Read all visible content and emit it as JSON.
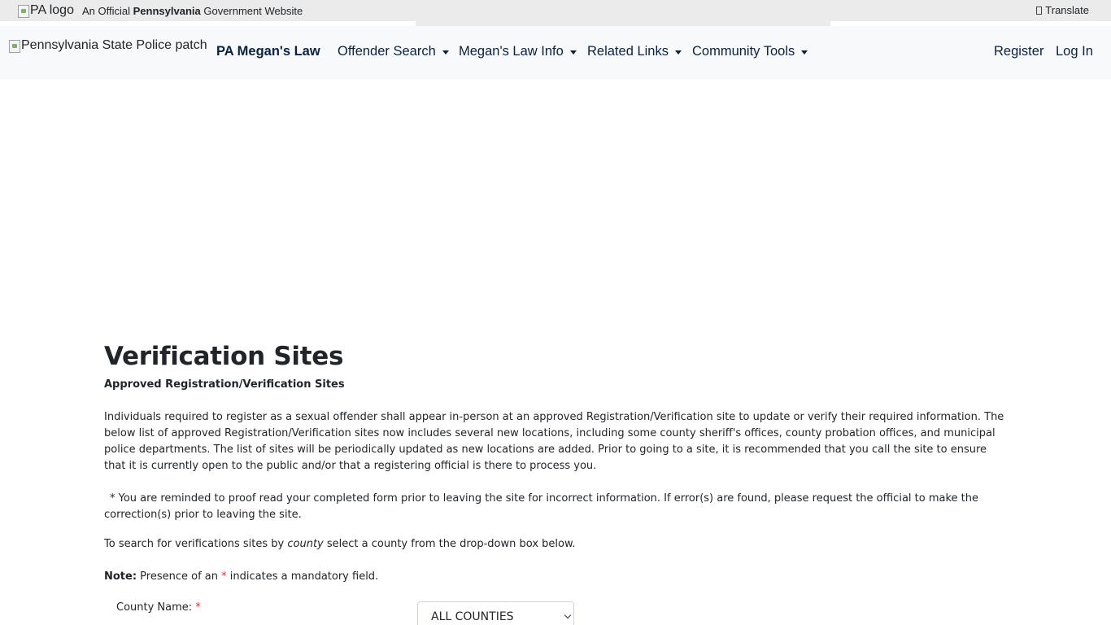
{
  "govbar": {
    "logo_alt": "PA logo",
    "official_prefix": "An Official ",
    "official_state": "Pennsylvania",
    "official_suffix": " Government Website",
    "translate_label": "Translate"
  },
  "navbar": {
    "patch_alt": "Pennsylvania State Police patch",
    "brand": "PA Megan's Law",
    "items": [
      {
        "label": "Offender Search"
      },
      {
        "label": "Megan's Law Info"
      },
      {
        "label": "Related Links"
      },
      {
        "label": "Community Tools"
      }
    ],
    "register": "Register",
    "login": "Log In"
  },
  "page": {
    "title": "Verification Sites",
    "subtitle": "Approved Registration/Verification Sites",
    "paragraph1": "Individuals required to register as a sexual offender shall appear in-person at an approved Registration/Verification site to update or verify their required information. The below list of approved Registration/Verification sites now includes several new locations, including some county sheriff's offices, county probation offices, and municipal police departments. The list of sites will be periodically updated as new locations are added. Prior to going to a site, it is recommended that you call the site to ensure that it is currently open to the public and/or that a registering official is there to process you.",
    "paragraph2": " * You are reminded to proof read your completed form prior to leaving the site for incorrect information. If error(s) are found, please request the official to make the correction(s) prior to leaving the site.",
    "search_prefix": "To search for verifications sites by ",
    "search_em": "county",
    "search_suffix": " select a county from the drop-down box below.",
    "note_label": "Note:",
    "note_prefix": " Presence of an ",
    "note_star": "*",
    "note_suffix": " indicates a mandatory field.",
    "county_label": "County Name:",
    "county_star": "*",
    "county_selected": "ALL COUNTIES"
  }
}
